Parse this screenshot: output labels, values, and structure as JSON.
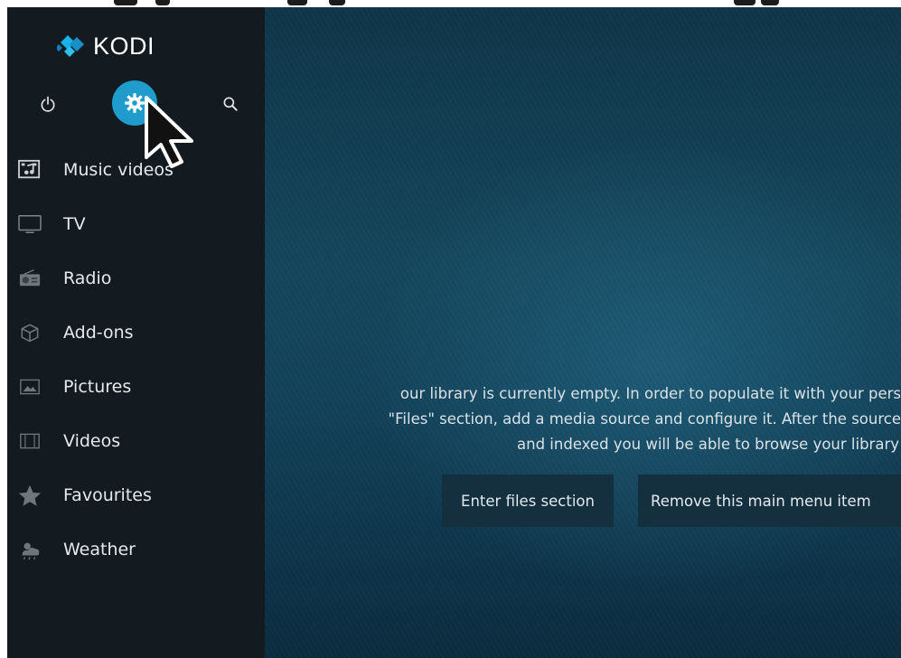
{
  "app": {
    "logo_text": "KODI",
    "accent_color": "#1f9ccb"
  },
  "toolbar": {
    "power_icon": "power-icon",
    "settings_icon": "gear-icon",
    "search_icon": "search-icon"
  },
  "sidebar": {
    "items": [
      {
        "label": "Music videos",
        "icon": "music-video-icon"
      },
      {
        "label": "TV",
        "icon": "tv-icon"
      },
      {
        "label": "Radio",
        "icon": "radio-icon"
      },
      {
        "label": "Add-ons",
        "icon": "addons-box-icon"
      },
      {
        "label": "Pictures",
        "icon": "picture-icon"
      },
      {
        "label": "Videos",
        "icon": "film-icon"
      },
      {
        "label": "Favourites",
        "icon": "star-icon"
      },
      {
        "label": "Weather",
        "icon": "weather-icon"
      }
    ]
  },
  "main": {
    "message_lines": [
      "our library is currently empty. In order to populate it with your pers",
      "\"Files\" section, add a media source and configure it. After the source",
      "and indexed you will be able to browse your library"
    ],
    "buttons": {
      "enter_files": "Enter files section",
      "remove_item": "Remove this main menu item"
    }
  }
}
